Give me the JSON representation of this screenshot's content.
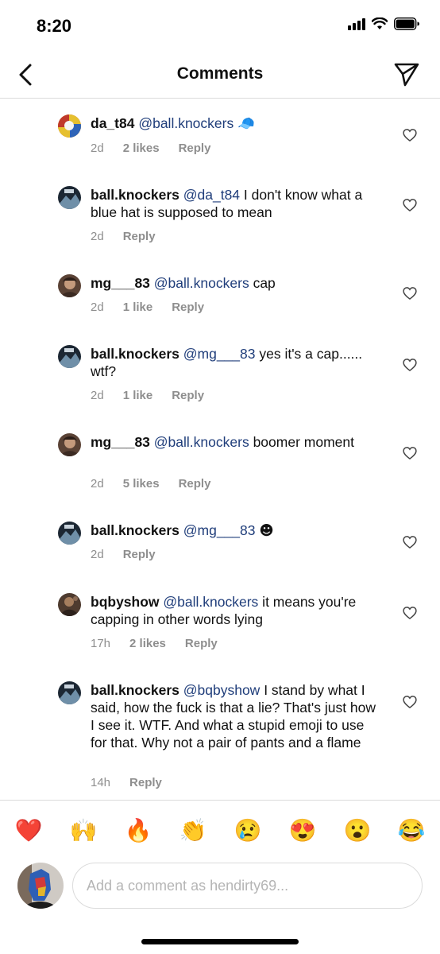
{
  "status_bar": {
    "time": "8:20"
  },
  "header": {
    "title": "Comments"
  },
  "comments": [
    {
      "username": "da_t84",
      "mention": "@ball.knockers",
      "text": "",
      "emoji": "🧢",
      "time": "2d",
      "likes": "2 likes",
      "reply": "Reply",
      "avatar_color": "#c0392b"
    },
    {
      "username": "ball.knockers",
      "mention": "@da_t84",
      "text": " I don't know what a blue hat is supposed to mean",
      "emoji": "",
      "time": "2d",
      "likes": "",
      "reply": "Reply",
      "avatar_color": "#2c3e50"
    },
    {
      "username": "mg___83",
      "mention": "@ball.knockers",
      "text": " cap",
      "emoji": "",
      "time": "2d",
      "likes": "1 like",
      "reply": "Reply",
      "avatar_color": "#6d4c41"
    },
    {
      "username": "ball.knockers",
      "mention": "@mg___83",
      "text": "  yes it's a cap...... wtf?",
      "emoji": "",
      "time": "2d",
      "likes": "1 like",
      "reply": "Reply",
      "avatar_color": "#2c3e50"
    },
    {
      "username": "mg___83",
      "mention": "@ball.knockers",
      "text": " boomer moment",
      "emoji": "",
      "time": "2d",
      "likes": "5 likes",
      "reply": "Reply",
      "avatar_color": "#6d4c41"
    },
    {
      "username": "ball.knockers",
      "mention": "@mg___83",
      "text": " ",
      "emoji": "☻",
      "time": "2d",
      "likes": "",
      "reply": "Reply",
      "avatar_color": "#2c3e50"
    },
    {
      "username": "bqbyshow",
      "mention": "@ball.knockers",
      "text": " it means you're capping in other words lying",
      "emoji": "",
      "time": "17h",
      "likes": "2 likes",
      "reply": "Reply",
      "avatar_color": "#5d4037"
    },
    {
      "username": "ball.knockers",
      "mention": "@bqbyshow",
      "text": " I stand by what I said, how the fuck is that a lie? That's just how I see it. WTF. And what a stupid emoji to use for that. Why not a pair of pants and a flame",
      "emoji": "",
      "time": "14h",
      "likes": "",
      "reply": "Reply",
      "avatar_color": "#2c3e50"
    }
  ],
  "reactions": [
    "❤️",
    "🙌",
    "🔥",
    "👏",
    "😢",
    "😍",
    "😮",
    "😂"
  ],
  "composer": {
    "placeholder": "Add a comment as hendirty69..."
  },
  "colors": {
    "mention": "#1f3d7a",
    "meta": "#8e8e8e",
    "divider": "#dbdbdb"
  },
  "icons": {
    "back": "chevron-left-icon",
    "send": "paper-plane-icon",
    "like": "heart-outline-icon"
  }
}
